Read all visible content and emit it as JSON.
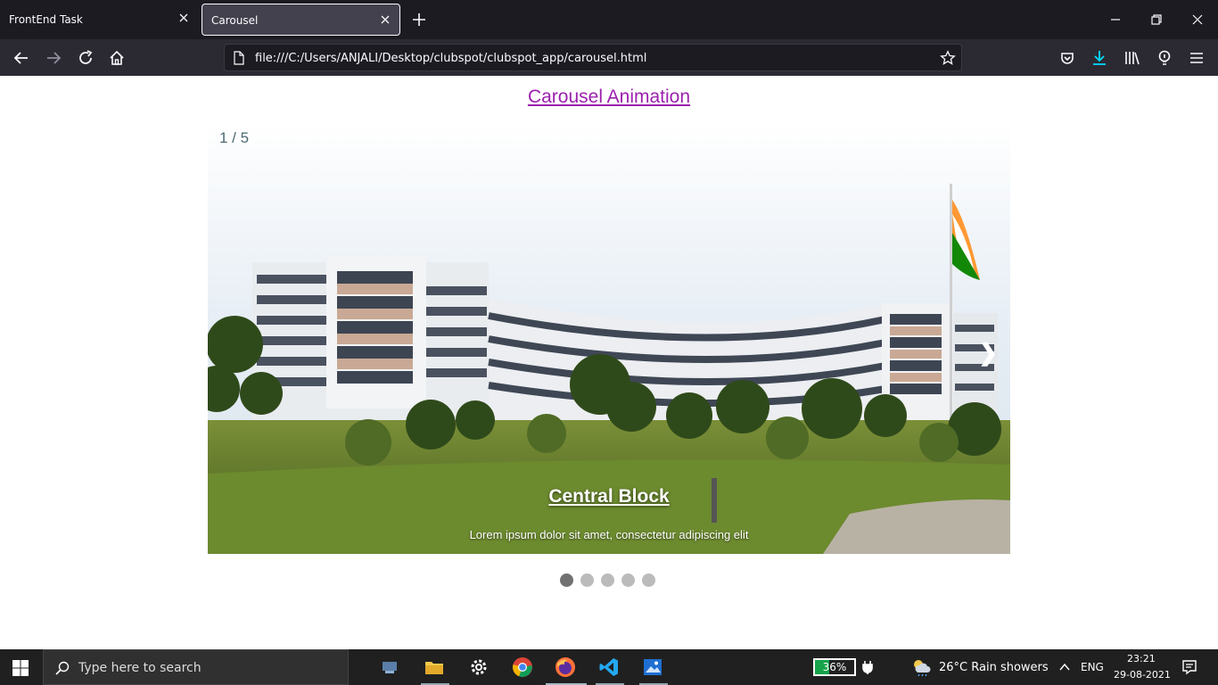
{
  "browser": {
    "tabs": [
      {
        "label": "FrontEnd Task"
      },
      {
        "label": "Carousel"
      }
    ],
    "url": "file:///C:/Users/ANJALI/Desktop/clubspot/clubspot_app/carousel.html"
  },
  "page": {
    "title": "Carousel Animation",
    "carousel": {
      "counter": "1 / 5",
      "next_symbol": "❯",
      "slide_title": "Central Block",
      "slide_text": "Lorem ipsum dolor sit amet, consectetur adipiscing elit",
      "dot_count": 5,
      "active_index": 0
    }
  },
  "taskbar": {
    "search_placeholder": "Type here to search",
    "battery": "36%",
    "battery_level": 0.36,
    "weather": "26°C  Rain showers",
    "language": "ENG",
    "time": "23:21",
    "date": "29-08-2021"
  },
  "colors": {
    "title_link": "#9b1fad",
    "counter": "#4c6a73",
    "active_dot": "#717171",
    "dot": "#bbbbbb"
  }
}
